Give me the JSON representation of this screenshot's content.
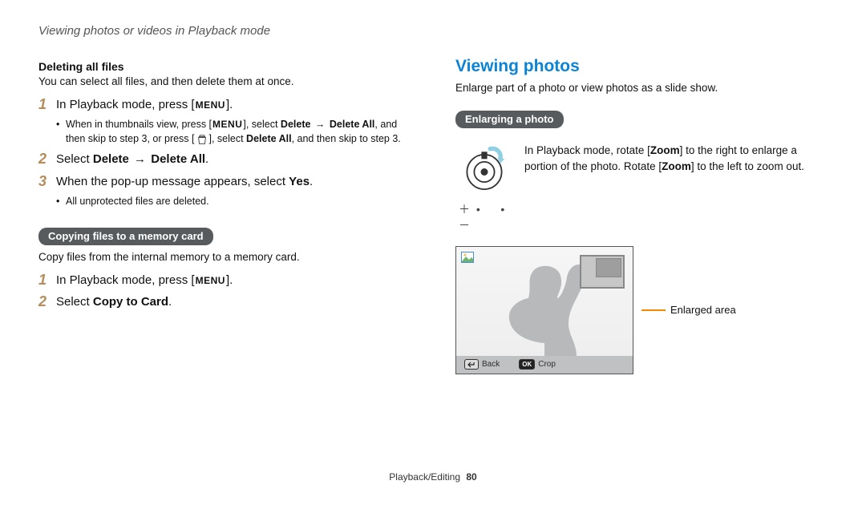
{
  "running_head": "Viewing photos or videos in Playback mode",
  "left": {
    "del_all_heading": "Deleting all files",
    "del_all_intro": "You can select all files, and then delete them at once.",
    "steps_a": {
      "s1_pre": "In Playback mode, press [",
      "s1_btn": "MENU",
      "s1_post": "].",
      "s1_sub_pre": "When in thumbnails view, press [",
      "s1_sub_btn": "MENU",
      "s1_sub_mid": "], select ",
      "s1_sub_del": "Delete",
      "s1_sub_arrow": " → ",
      "s1_sub_delall": "Delete All",
      "s1_sub_mid2": ", and then skip to step 3, or press [",
      "s1_sub_mid3": "], select ",
      "s1_sub_delall2": "Delete All",
      "s1_sub_end": ", and then skip to step 3.",
      "s2_pre": "Select ",
      "s2_del": "Delete",
      "s2_arrow": " → ",
      "s2_delall": "Delete All",
      "s2_post": ".",
      "s3_pre": "When the pop-up message appears, select ",
      "s3_yes": "Yes",
      "s3_post": ".",
      "s3_sub": "All unprotected files are deleted."
    },
    "copy_pill": "Copying files to a memory card",
    "copy_intro": "Copy files from the internal memory to a memory card.",
    "steps_b": {
      "s1_pre": "In Playback mode, press [",
      "s1_btn": "MENU",
      "s1_post": "].",
      "s2_pre": "Select ",
      "s2_b": "Copy to Card",
      "s2_post": "."
    }
  },
  "right": {
    "title": "Viewing photos",
    "intro": "Enlarge part of a photo or view photos as a slide show.",
    "pill": "Enlarging a photo",
    "desc_pre": "In Playback mode, rotate [",
    "desc_zoom": "Zoom",
    "desc_mid": "] to the right to enlarge a portion of the photo. Rotate [",
    "desc_zoom2": "Zoom",
    "desc_post": "] to the left to zoom out.",
    "plusminus_plus": "＋",
    "plusminus_dot": "•",
    "plusminus_minus": "－",
    "back_label": "Back",
    "crop_label": "Crop",
    "ok_key": "OK",
    "enlarged_label": "Enlarged area"
  },
  "footer": {
    "section": "Playback/Editing",
    "page": "80"
  }
}
